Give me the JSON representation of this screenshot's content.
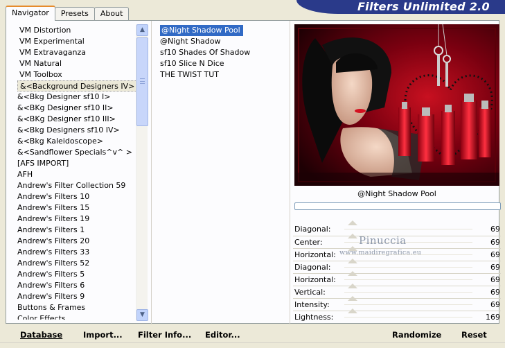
{
  "app": {
    "title": "Filters Unlimited 2.0"
  },
  "tabs": [
    {
      "label": "Navigator"
    },
    {
      "label": "Presets"
    },
    {
      "label": "About"
    }
  ],
  "categories": [
    "VM Distortion",
    "VM Experimental",
    "VM Extravaganza",
    "VM Natural",
    "VM Toolbox",
    "&<Background Designers IV>",
    "&<Bkg Designer sf10 I>",
    "&<BKg Designer sf10 II>",
    "&<BKg Designer sf10 III>",
    "&<Bkg Designers sf10 IV>",
    "&<Bkg Kaleidoscope>",
    "&<Sandflower Specials^v^ >",
    "[AFS IMPORT]",
    "AFH",
    "Andrew's Filter Collection 59",
    "Andrew's Filters 10",
    "Andrew's Filters 15",
    "Andrew's Filters 19",
    "Andrew's Filters 1",
    "Andrew's Filters 20",
    "Andrew's Filters 33",
    "Andrew's Filters 52",
    "Andrew's Filters 5",
    "Andrew's Filters 6",
    "Andrew's Filters 9",
    "Buttons & Frames",
    "Color Effects"
  ],
  "selected_category_index": 5,
  "filters": [
    "@Night Shadow Pool",
    "@Night Shadow",
    "sf10 Shades Of Shadow",
    "sf10 Slice N Dice",
    "THE TWIST TUT"
  ],
  "selected_filter_index": 0,
  "preview": {
    "filter_name": "@Night Shadow Pool"
  },
  "sliders": [
    {
      "label": "Diagonal:",
      "value": "69"
    },
    {
      "label": "Center:",
      "value": "69"
    },
    {
      "label": "Horizontal:",
      "value": "69"
    },
    {
      "label": "Diagonal:",
      "value": "69"
    },
    {
      "label": "Horizontal:",
      "value": "69"
    },
    {
      "label": "Vertical:",
      "value": "69"
    },
    {
      "label": "Intensity:",
      "value": "69"
    },
    {
      "label": "Lightness:",
      "value": "169"
    }
  ],
  "watermark": {
    "name": "Pinuccia",
    "site": "www.maidiregrafica.eu"
  },
  "buttons": {
    "database": "Database",
    "import": "Import...",
    "filter_info": "Filter Info...",
    "editor": "Editor...",
    "randomize": "Randomize",
    "reset": "Reset"
  },
  "colors": {
    "banner": "#2a3a8a",
    "selection": "#316ac5",
    "active_tab_accent": "#e68b2c"
  }
}
